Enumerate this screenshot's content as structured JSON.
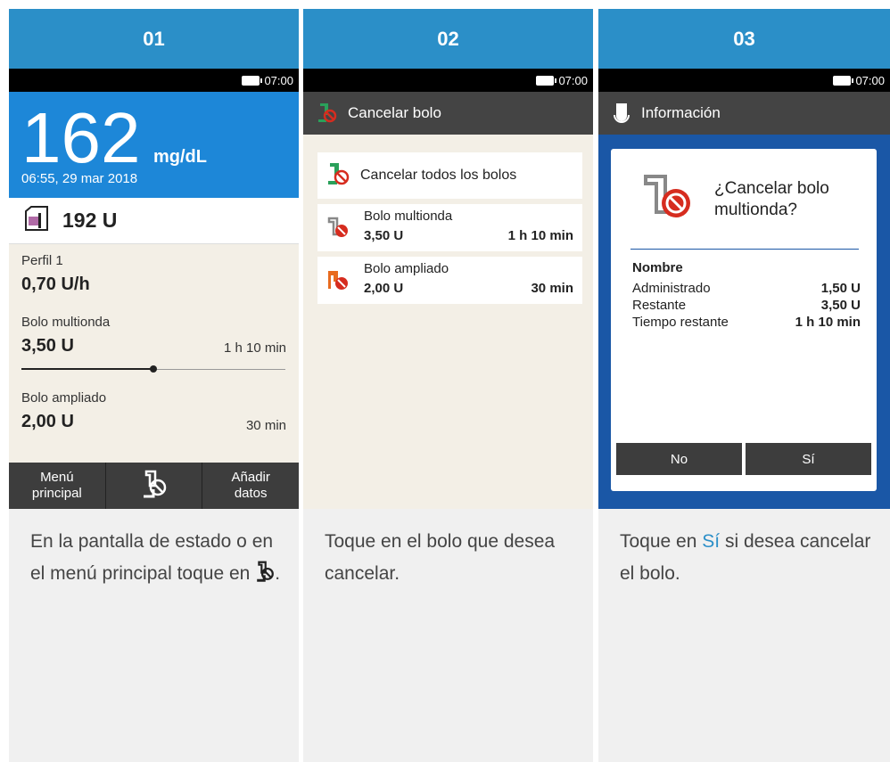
{
  "colors": {
    "step_header": "#2b8fc8",
    "glucose_bg": "#1d87d8",
    "status_bg": "#f3efe6",
    "dialog_bg": "#1a57a6",
    "dark_bar": "#3d3d3d",
    "cancel_red": "#d62c1f",
    "pump_green": "#2aa05a",
    "extended_orange": "#e86b1f"
  },
  "status": {
    "time": "07:00",
    "battery_icon": "battery-icon"
  },
  "panel1": {
    "step": "01",
    "glucose_value": "162",
    "glucose_unit": "mg/dL",
    "glucose_time": "06:55, 29 mar 2018",
    "reservoir_value": "192 U",
    "basal_label": "Perfil 1",
    "basal_value": "0,70 U/h",
    "multiwave_label": "Bolo multionda",
    "multiwave_value": "3,50 U",
    "multiwave_time": "1 h 10 min",
    "multiwave_progress": 0.5,
    "extended_label": "Bolo ampliado",
    "extended_value": "2,00 U",
    "extended_time": "30 min",
    "nav_left_line1": "Menú",
    "nav_left_line2": "principal",
    "nav_right_line1": "Añadir",
    "nav_right_line2": "datos",
    "caption_text": "En la pantalla de estado o en el menú principal toque en",
    "caption_end": "."
  },
  "panel2": {
    "step": "02",
    "title": "Cancelar bolo",
    "cancel_all": "Cancelar todos los bolos",
    "items": [
      {
        "name": "Bolo multionda",
        "amount": "3,50 U",
        "time": "1 h 10 min"
      },
      {
        "name": "Bolo ampliado",
        "amount": "2,00 U",
        "time": "30 min"
      }
    ],
    "caption_text": "Toque en el bolo que desea cancelar."
  },
  "panel3": {
    "step": "03",
    "title": "Información",
    "question": "¿Cancelar bolo multionda?",
    "name_label": "Nombre",
    "rows": [
      {
        "label": "Administrado",
        "value": "1,50 U"
      },
      {
        "label": "Restante",
        "value": "3,50 U"
      },
      {
        "label": "Tiempo restante",
        "value": "1 h 10 min"
      }
    ],
    "btn_no": "No",
    "btn_yes": "Sí",
    "caption_pre": "Toque en",
    "caption_accent": "Sí",
    "caption_post": "si desea cancelar el bolo."
  }
}
